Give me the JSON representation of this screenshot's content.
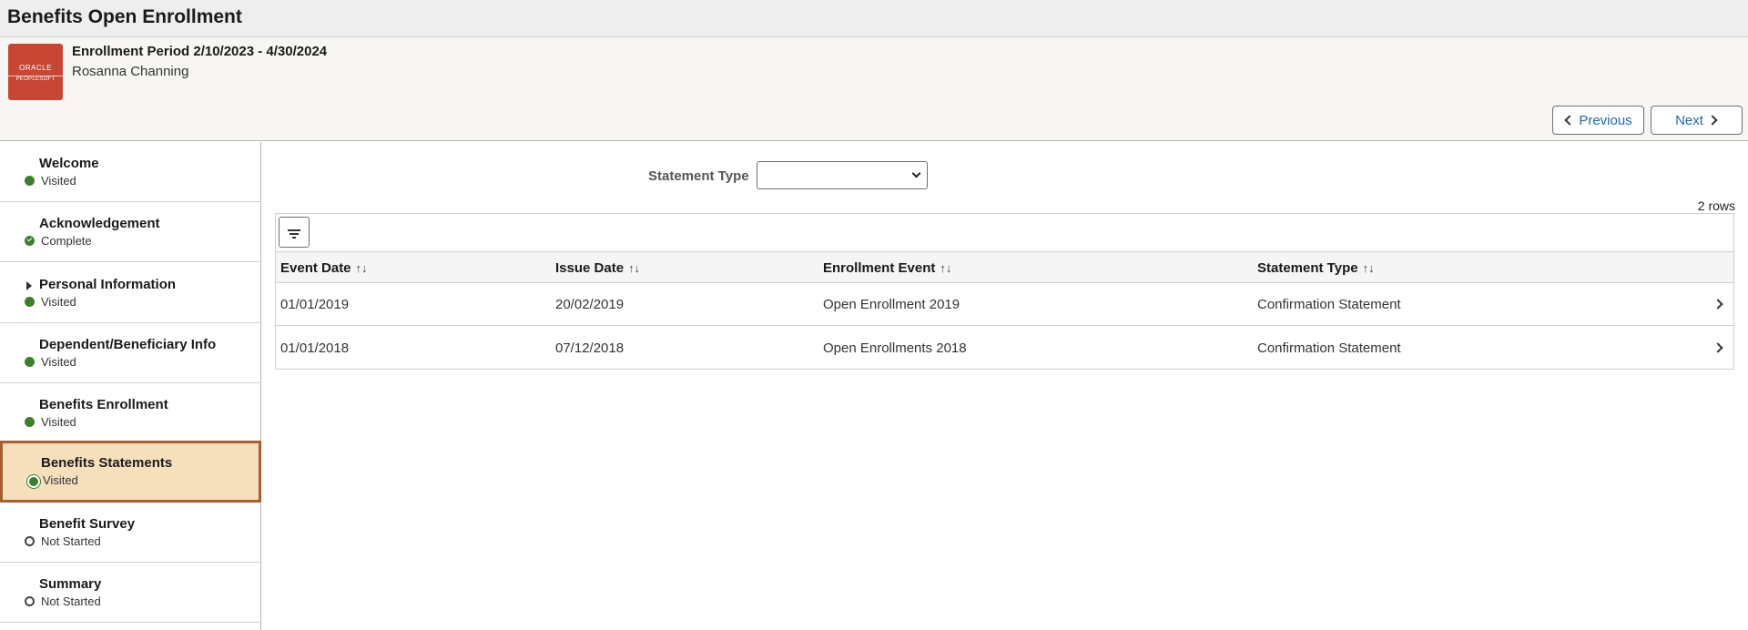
{
  "page": {
    "title": "Benefits Open Enrollment"
  },
  "header": {
    "logo_line1": "ORACLE",
    "logo_line2": "PEOPLESOFT",
    "period": "Enrollment Period 2/10/2023 - 4/30/2024",
    "person": "Rosanna Channing",
    "previous_label": "Previous",
    "next_label": "Next"
  },
  "sidebar": {
    "items": [
      {
        "label": "Welcome",
        "status": "Visited",
        "state": "visited"
      },
      {
        "label": "Acknowledgement",
        "status": "Complete",
        "state": "complete"
      },
      {
        "label": "Personal Information",
        "status": "Visited",
        "state": "visited",
        "expandable": true
      },
      {
        "label": "Dependent/Beneficiary Info",
        "status": "Visited",
        "state": "visited"
      },
      {
        "label": "Benefits Enrollment",
        "status": "Visited",
        "state": "visited"
      },
      {
        "label": "Benefits Statements",
        "status": "Visited",
        "state": "visited",
        "selected": true
      },
      {
        "label": "Benefit Survey",
        "status": "Not Started",
        "state": "not-started"
      },
      {
        "label": "Summary",
        "status": "Not Started",
        "state": "not-started"
      }
    ]
  },
  "main": {
    "filter_label": "Statement Type",
    "filter_value": "",
    "row_count": "2 rows",
    "columns": [
      "Event Date",
      "Issue Date",
      "Enrollment Event",
      "Statement Type"
    ],
    "rows": [
      [
        "01/01/2019",
        "20/02/2019",
        "Open Enrollment 2019",
        "Confirmation Statement"
      ],
      [
        "01/01/2018",
        "07/12/2018",
        "Open Enrollments 2018",
        "Confirmation Statement"
      ]
    ]
  }
}
